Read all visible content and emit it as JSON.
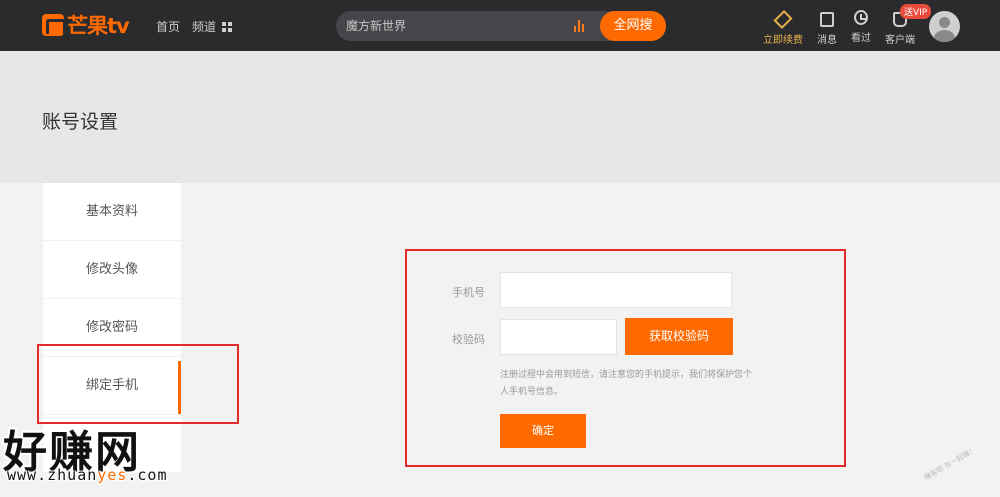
{
  "header": {
    "logo_text": "芒果tv",
    "nav": {
      "home": "首页",
      "channel": "频道"
    },
    "search": {
      "value": "魔方新世界",
      "button": "全网搜"
    },
    "tools": {
      "vip": "立即续费",
      "messages": "消息",
      "history": "看过",
      "client": "客户端"
    },
    "vip_badge": "送VIP"
  },
  "page": {
    "title": "账号设置"
  },
  "sidebar": {
    "items": [
      {
        "label": "基本资料"
      },
      {
        "label": "修改头像"
      },
      {
        "label": "修改密码"
      },
      {
        "label": "绑定手机"
      },
      {
        "label": ""
      }
    ]
  },
  "form": {
    "phone_label": "手机号",
    "phone_value": "",
    "code_label": "校验码",
    "code_value": "",
    "get_code_button": "获取校验码",
    "notice": "注册过程中会用到短信，请注意您的手机提示，我们将保护您个人手机号信息。",
    "confirm_button": "确定"
  },
  "watermark": {
    "title": "好赚网",
    "url_pre": "www.zhuan",
    "url_hi": "yes",
    "url_post": ".com",
    "corner": "赚客吧 有一起赚！"
  },
  "colors": {
    "accent": "#ff6a00",
    "topbar": "#2b2b2d",
    "highlight": "#e12b2b"
  }
}
